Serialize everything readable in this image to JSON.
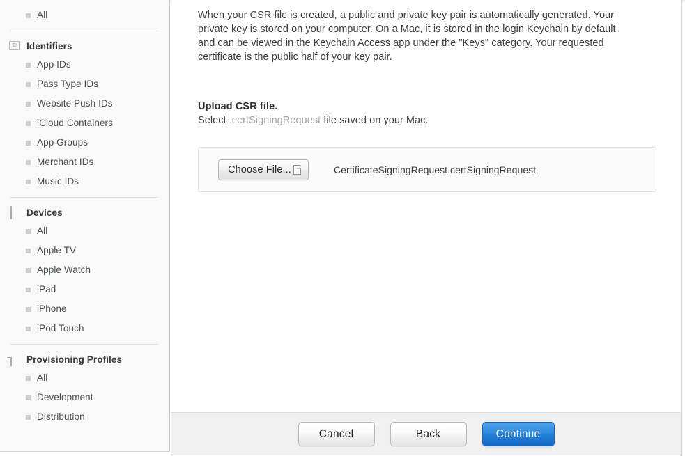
{
  "sidebar": {
    "top_items": [
      {
        "label": "All",
        "icon": "bullet-icon"
      }
    ],
    "groups": [
      {
        "title": "Identifiers",
        "icon": "id-badge-icon",
        "items": [
          {
            "label": "App IDs"
          },
          {
            "label": "Pass Type IDs"
          },
          {
            "label": "Website Push IDs"
          },
          {
            "label": "iCloud Containers"
          },
          {
            "label": "App Groups"
          },
          {
            "label": "Merchant IDs"
          },
          {
            "label": "Music IDs"
          }
        ]
      },
      {
        "title": "Devices",
        "icon": "phone-icon",
        "items": [
          {
            "label": "All"
          },
          {
            "label": "Apple TV"
          },
          {
            "label": "Apple Watch"
          },
          {
            "label": "iPad"
          },
          {
            "label": "iPhone"
          },
          {
            "label": "iPod Touch"
          }
        ]
      },
      {
        "title": "Provisioning Profiles",
        "icon": "document-icon",
        "items": [
          {
            "label": "All"
          },
          {
            "label": "Development"
          },
          {
            "label": "Distribution"
          }
        ]
      }
    ]
  },
  "main": {
    "paragraph": "When your CSR file is created, a public and private key pair is automatically generated. Your private key is stored on your computer. On a Mac, it is stored in the login Keychain by default and can be viewed in the Keychain Access app under the \"Keys\" category. Your requested certificate is the public half of your key pair.",
    "upload": {
      "heading": "Upload CSR file.",
      "subtitle_prefix": "Select ",
      "subtitle_extension": ".certSigningRequest",
      "subtitle_suffix": " file saved on your Mac.",
      "choose_file_label": "Choose File...",
      "selected_file_name": "CertificateSigningRequest.certSigningRequest"
    }
  },
  "footer": {
    "cancel_label": "Cancel",
    "back_label": "Back",
    "continue_label": "Continue"
  },
  "colors": {
    "accent": "#2280da",
    "sidebar_bg": "#f8f9f8",
    "footer_bg": "#f0f0f0",
    "muted_text": "#a2a5a4"
  }
}
